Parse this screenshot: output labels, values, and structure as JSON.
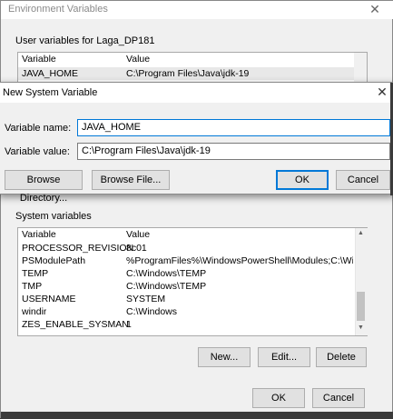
{
  "env_window": {
    "title": "Environment Variables",
    "close_glyph": "✕",
    "user_group_label": "User variables for Laga_DP181",
    "user_table": {
      "headers": [
        "Variable",
        "Value"
      ],
      "rows": [
        [
          "JAVA_HOME",
          "C:\\Program Files\\Java\\jdk-19"
        ]
      ]
    },
    "system_group_label": "System variables",
    "system_table": {
      "headers": [
        "Variable",
        "Value"
      ],
      "rows": [
        [
          "PROCESSOR_REVISION",
          "8c01"
        ],
        [
          "PSModulePath",
          "%ProgramFiles%\\WindowsPowerShell\\Modules;C:\\Windows\\s..."
        ],
        [
          "TEMP",
          "C:\\Windows\\TEMP"
        ],
        [
          "TMP",
          "C:\\Windows\\TEMP"
        ],
        [
          "USERNAME",
          "SYSTEM"
        ],
        [
          "windir",
          "C:\\Windows"
        ],
        [
          "ZES_ENABLE_SYSMAN",
          "1"
        ]
      ]
    },
    "buttons": {
      "new": "New...",
      "edit": "Edit...",
      "delete": "Delete",
      "ok": "OK",
      "cancel": "Cancel"
    }
  },
  "new_system_variable": {
    "title": "New System Variable",
    "close_glyph": "✕",
    "name_label": "Variable name:",
    "value_label": "Variable value:",
    "name_value": "JAVA_HOME",
    "value_value": "C:\\Program Files\\Java\\jdk-19",
    "buttons": {
      "browse_directory": "Browse Directory...",
      "browse_file": "Browse File...",
      "ok": "OK",
      "cancel": "Cancel"
    }
  },
  "colors": {
    "accent": "#0078d7",
    "selected_row": "#e8e8e8",
    "dialog_bg": "#f0f0f0"
  }
}
